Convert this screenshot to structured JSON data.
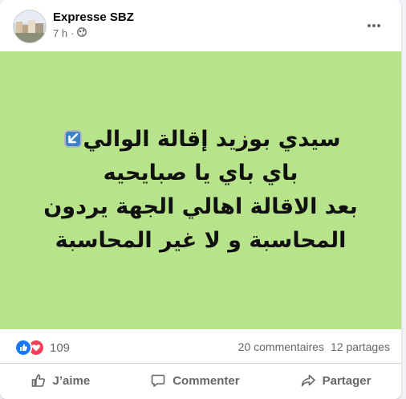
{
  "post": {
    "author": "Expresse SBZ",
    "time": "7 h",
    "separator": "·",
    "lines": [
      "سيدي بوزيد إقالة الوالي",
      "باي باي يا صبايحيه",
      "بعد الاقالة اهالي الجهة يردون",
      "المحاسبة و لا غير المحاسبة"
    ],
    "background_color": "#b7e38b"
  },
  "stats": {
    "reaction_count": "109",
    "comments": "20 commentaires",
    "shares": "12 partages"
  },
  "actions": {
    "like": "J’aime",
    "comment": "Commenter",
    "share": "Partager"
  },
  "icons": {
    "privacy": "globe-icon",
    "more": "ellipsis-icon",
    "reactions": [
      "like-reaction-icon",
      "love-reaction-icon"
    ],
    "emoji": "arrow-down-left-emoji"
  }
}
